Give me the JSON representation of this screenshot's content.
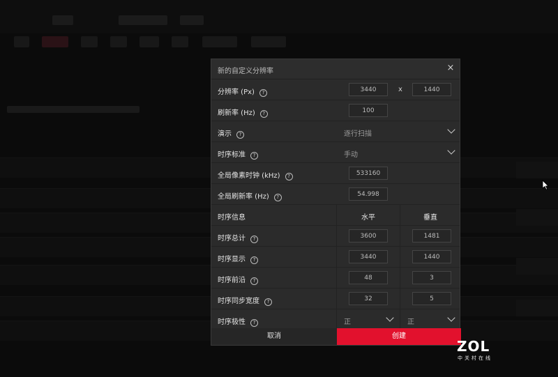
{
  "dialog": {
    "title": "新的自定义分辨率",
    "close_glyph": "×",
    "resolution": {
      "label": "分辨率 (Px)",
      "width": "3440",
      "separator": "x",
      "height": "1440"
    },
    "refresh_rate": {
      "label": "刷新率 (Hz)",
      "value": "100"
    },
    "presentation": {
      "label": "演示",
      "value": "逐行扫描"
    },
    "timing_standard": {
      "label": "时序标准",
      "value": "手动"
    },
    "pixel_clock": {
      "label": "全局像素时钟 (kHz)",
      "value": "533160"
    },
    "global_refresh": {
      "label": "全局刷新率 (Hz)",
      "value": "54.998"
    },
    "timing_info": {
      "label": "时序信息",
      "horizontal": "水平",
      "vertical": "垂直"
    },
    "timing_total": {
      "label": "时序总计",
      "h": "3600",
      "v": "1481"
    },
    "timing_display": {
      "label": "时序显示",
      "h": "3440",
      "v": "1440"
    },
    "front_porch": {
      "label": "时序前沿",
      "h": "48",
      "v": "3"
    },
    "sync_width": {
      "label": "时序同步宽度",
      "h": "32",
      "v": "5"
    },
    "polarity": {
      "label": "时序极性",
      "h": "正",
      "v": "正"
    },
    "cancel_label": "取消",
    "create_label": "创建",
    "help_glyph": "?"
  },
  "watermark": {
    "logo": "ZOL",
    "sub": "中关村在线"
  },
  "colors": {
    "accent": "#e2112d",
    "dialog_bg": "#2b2b2b"
  }
}
